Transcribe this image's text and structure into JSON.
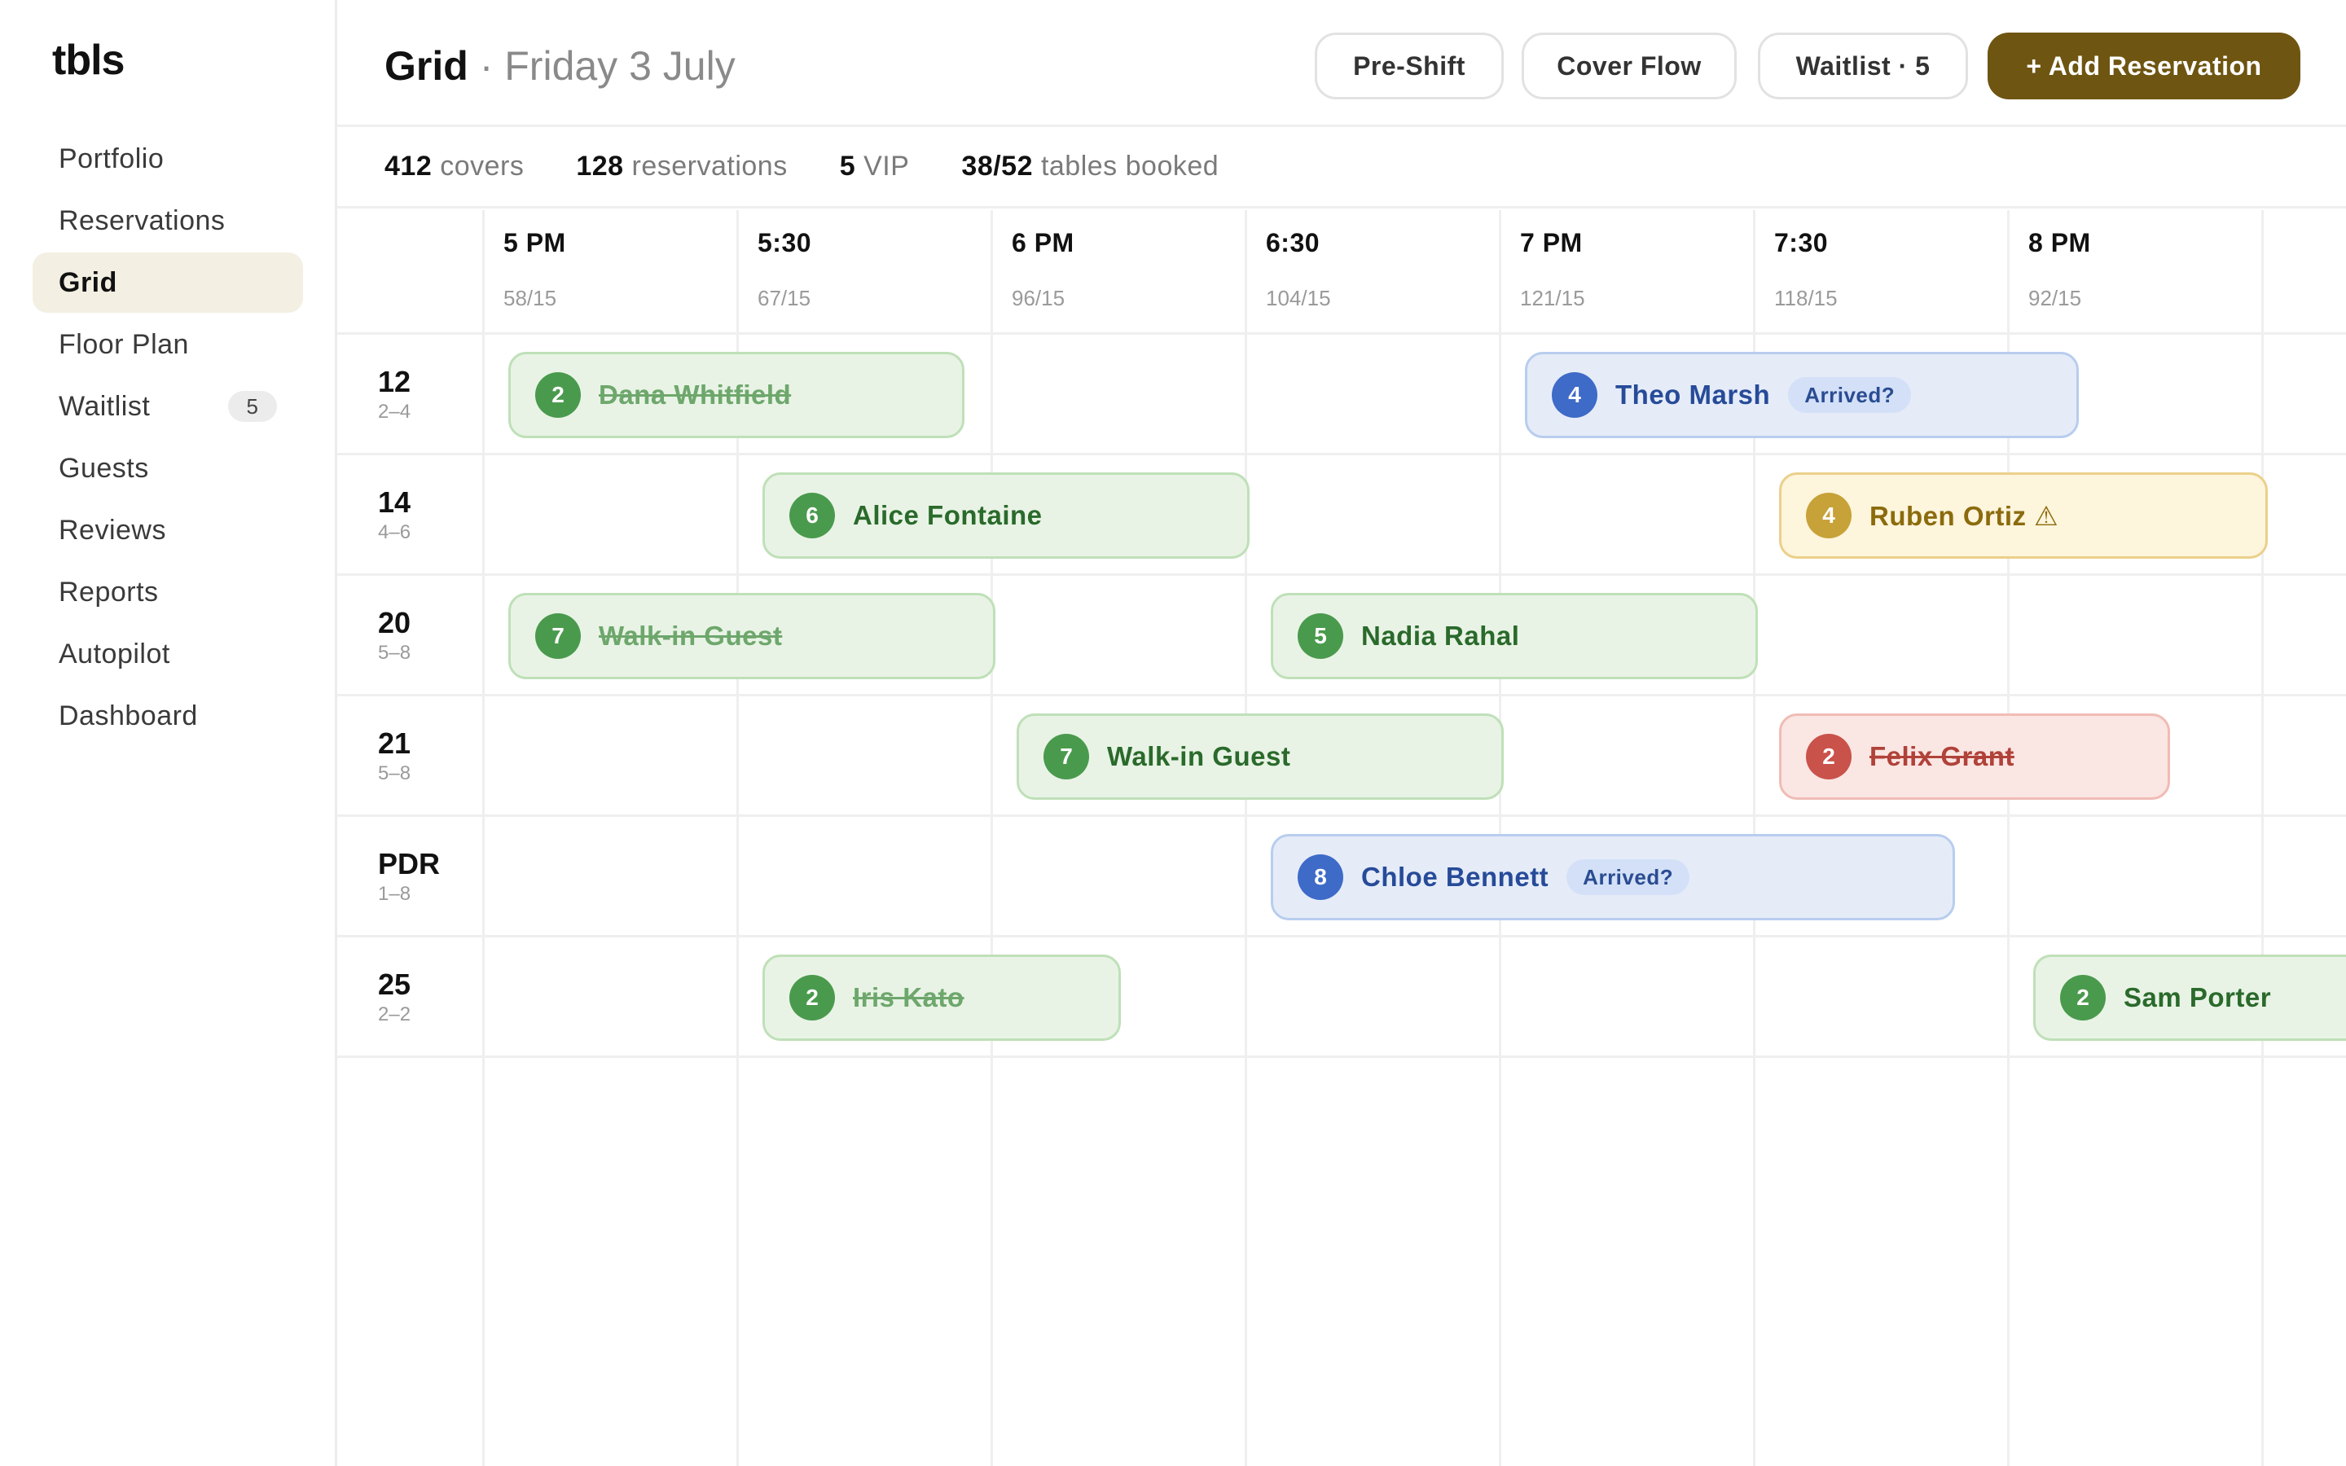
{
  "app": {
    "brand": "tbls"
  },
  "sidebar": {
    "items": [
      {
        "label": "Portfolio"
      },
      {
        "label": "Reservations"
      },
      {
        "label": "Grid"
      },
      {
        "label": "Floor Plan"
      },
      {
        "label": "Waitlist",
        "badge": "5"
      },
      {
        "label": "Guests"
      },
      {
        "label": "Reviews"
      },
      {
        "label": "Reports"
      },
      {
        "label": "Autopilot"
      },
      {
        "label": "Dashboard"
      }
    ]
  },
  "header": {
    "title": "Grid",
    "separator": "·",
    "date": "Friday 3 July",
    "buttons": {
      "preshift": "Pre-Shift",
      "cover_flow": "Cover Flow",
      "waitlist": "Waitlist · 5",
      "add": "+ Add Reservation"
    }
  },
  "stats": {
    "covers_value": "412",
    "covers_label": "covers",
    "reservations_value": "128",
    "reservations_label": "reservations",
    "vip_value": "5",
    "vip_label": "VIP",
    "tables_value": "38/52",
    "tables_label": "tables booked"
  },
  "grid": {
    "times": [
      {
        "label": "5 PM",
        "count": "58/15"
      },
      {
        "label": "5:30",
        "count": "67/15"
      },
      {
        "label": "6 PM",
        "count": "96/15"
      },
      {
        "label": "6:30",
        "count": "104/15"
      },
      {
        "label": "7 PM",
        "count": "121/15"
      },
      {
        "label": "7:30",
        "count": "118/15"
      },
      {
        "label": "8 PM",
        "count": "92/15"
      }
    ],
    "tables": [
      {
        "name": "12",
        "range": "2–4"
      },
      {
        "name": "14",
        "range": "4–6"
      },
      {
        "name": "20",
        "range": "5–8"
      },
      {
        "name": "21",
        "range": "5–8"
      },
      {
        "name": "PDR",
        "range": "1–8"
      },
      {
        "name": "25",
        "range": "2–2"
      }
    ],
    "reservations": [
      {
        "party": "2",
        "guest": "Dana Whitfield"
      },
      {
        "party": "4",
        "guest": "Theo Marsh",
        "tag": "Arrived?"
      },
      {
        "party": "6",
        "guest": "Alice Fontaine"
      },
      {
        "party": "4",
        "guest": "Ruben Ortiz ⚠"
      },
      {
        "party": "7",
        "guest": "Walk-in Guest"
      },
      {
        "party": "5",
        "guest": "Nadia Rahal"
      },
      {
        "party": "7",
        "guest": "Walk-in Guest"
      },
      {
        "party": "2",
        "guest": "Felix Grant"
      },
      {
        "party": "8",
        "guest": "Chloe Bennett",
        "tag": "Arrived?"
      },
      {
        "party": "2",
        "guest": "Iris Kato"
      },
      {
        "party": "2",
        "guest": "Sam Porter"
      }
    ]
  }
}
